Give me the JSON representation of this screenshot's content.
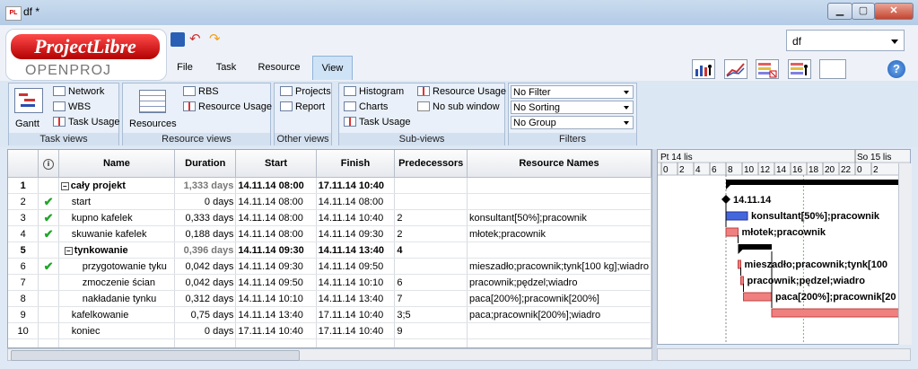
{
  "window": {
    "title": "df *",
    "app_icon_text": "PL"
  },
  "logo": {
    "top": "ProjectLibre",
    "sub": "OPENPROJ"
  },
  "menu": {
    "tabs": [
      "File",
      "Task",
      "Resource",
      "View"
    ],
    "active": "View"
  },
  "project_select": {
    "value": "df"
  },
  "ribbon": {
    "task_views": {
      "caption": "Task views",
      "gantt": "Gantt",
      "items": [
        "Network",
        "WBS",
        "Task Usage"
      ]
    },
    "resource_views": {
      "caption": "Resource views",
      "resources": "Resources",
      "items": [
        "RBS",
        "Resource Usage"
      ]
    },
    "other_views": {
      "caption": "Other views",
      "items": [
        "Projects",
        "Report"
      ]
    },
    "sub_views": {
      "caption": "Sub-views",
      "col1": [
        "Histogram",
        "Charts",
        "Task Usage"
      ],
      "col2": [
        "Resource Usage",
        "No sub window"
      ]
    },
    "filters": {
      "caption": "Filters",
      "items": [
        "No Filter",
        "No Sorting",
        "No Group"
      ]
    }
  },
  "table": {
    "headers": [
      "",
      "",
      "Name",
      "Duration",
      "Start",
      "Finish",
      "Predecessors",
      "Resource Names"
    ],
    "rows": [
      {
        "id": "1",
        "check": false,
        "name": "cały projekt",
        "indent": 0,
        "summary": true,
        "toggle": "−",
        "duration": "1,333 days",
        "start": "14.11.14 08:00",
        "finish": "17.11.14 10:40",
        "pred": "",
        "res": ""
      },
      {
        "id": "2",
        "check": true,
        "name": "start",
        "indent": 1,
        "summary": false,
        "toggle": "",
        "duration": "0 days",
        "start": "14.11.14 08:00",
        "finish": "14.11.14 08:00",
        "pred": "",
        "res": ""
      },
      {
        "id": "3",
        "check": true,
        "name": "kupno kafelek",
        "indent": 1,
        "summary": false,
        "toggle": "",
        "duration": "0,333 days",
        "start": "14.11.14 08:00",
        "finish": "14.11.14 10:40",
        "pred": "2",
        "res": "konsultant[50%];pracownik"
      },
      {
        "id": "4",
        "check": true,
        "name": "skuwanie kafelek",
        "indent": 1,
        "summary": false,
        "toggle": "",
        "duration": "0,188 days",
        "start": "14.11.14 08:00",
        "finish": "14.11.14 09:30",
        "pred": "2",
        "res": "młotek;pracownik"
      },
      {
        "id": "5",
        "check": false,
        "name": "tynkowanie",
        "indent": 1,
        "summary": true,
        "toggle": "−",
        "duration": "0,396 days",
        "start": "14.11.14 09:30",
        "finish": "14.11.14 13:40",
        "pred": "4",
        "res": ""
      },
      {
        "id": "6",
        "check": true,
        "name": "przygotowanie tyku",
        "indent": 2,
        "summary": false,
        "toggle": "",
        "duration": "0,042 days",
        "start": "14.11.14 09:30",
        "finish": "14.11.14 09:50",
        "pred": "",
        "res": "mieszadło;pracownik;tynk[100 kg];wiadro"
      },
      {
        "id": "7",
        "check": false,
        "name": "zmoczenie ścian",
        "indent": 2,
        "summary": false,
        "toggle": "",
        "duration": "0,042 days",
        "start": "14.11.14 09:50",
        "finish": "14.11.14 10:10",
        "pred": "6",
        "res": "pracownik;pędzel;wiadro"
      },
      {
        "id": "8",
        "check": false,
        "name": "nakładanie tynku",
        "indent": 2,
        "summary": false,
        "toggle": "",
        "duration": "0,312 days",
        "start": "14.11.14 10:10",
        "finish": "14.11.14 13:40",
        "pred": "7",
        "res": "paca[200%];pracownik[200%]"
      },
      {
        "id": "9",
        "check": false,
        "name": "kafelkowanie",
        "indent": 1,
        "summary": false,
        "toggle": "",
        "duration": "0,75 days",
        "start": "14.11.14 13:40",
        "finish": "17.11.14 10:40",
        "pred": "3;5",
        "res": "paca;pracownik[200%];wiadro"
      },
      {
        "id": "10",
        "check": false,
        "name": "koniec",
        "indent": 1,
        "summary": false,
        "toggle": "",
        "duration": "0 days",
        "start": "17.11.14 10:40",
        "finish": "17.11.14 10:40",
        "pred": "9",
        "res": ""
      }
    ]
  },
  "gantt": {
    "header_left": "Pt 14 lis",
    "header_right": "So 15 lis",
    "hours": [
      "0",
      "2",
      "4",
      "6",
      "8",
      "10",
      "12",
      "14",
      "16",
      "18",
      "20",
      "22",
      "0",
      "2"
    ],
    "milestone_label": "14.11.14",
    "bar_labels": [
      "konsultant[50%];pracownik",
      "młotek;pracownik",
      "mieszadło;pracownik;tynk[100",
      "pracownik;pędzel;wiadro",
      "paca[200%];pracownik[20"
    ]
  },
  "colors": {
    "accent": "#cfe3f7",
    "check": "#22a52b",
    "bar_red": "#f08080",
    "bar_blue": "#4466dd"
  }
}
